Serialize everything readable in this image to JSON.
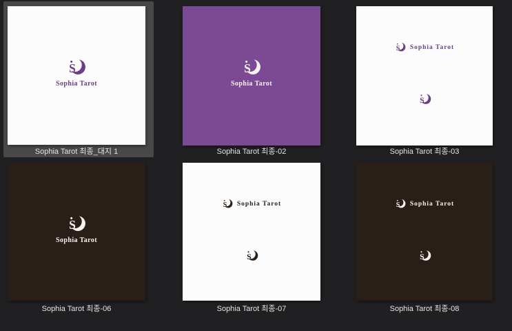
{
  "page": {
    "background": "#202022",
    "selection_highlight_color": "#48484a",
    "label_color": "#e4e4e4"
  },
  "brand": {
    "monogram": "S",
    "wordmark": "Sophia Tarot",
    "logo_purple": "#6b3f87",
    "card_purple": "#7c4a94",
    "card_dark_brown": "#2a1f18",
    "card_white": "#fcfcfc",
    "logo_light": "#f6f3ef"
  },
  "icons": {
    "logo_mark": "crescent-moon-with-monogram",
    "logo_dot": "accent-dot"
  },
  "tiles": [
    {
      "label": "Sophia Tarot 최종_대지 1",
      "layout": "stacked-center",
      "background": "white",
      "ink": "purple",
      "selected": true
    },
    {
      "label": "Sophia Tarot 최종-02",
      "layout": "stacked-center",
      "background": "purple",
      "ink": "light",
      "selected": false
    },
    {
      "label": "Sophia Tarot 최종-03",
      "layout": "horizontal-plus-solo",
      "background": "white",
      "ink": "purple",
      "selected": false
    },
    {
      "label": "Sophia Tarot 최종-06",
      "layout": "stacked-center",
      "background": "dark",
      "ink": "light",
      "selected": false
    },
    {
      "label": "Sophia Tarot 최종-07",
      "layout": "horizontal-plus-solo",
      "background": "white",
      "ink": "dark",
      "selected": false
    },
    {
      "label": "Sophia Tarot 최종-08",
      "layout": "horizontal-plus-solo",
      "background": "dark",
      "ink": "light",
      "selected": false
    }
  ]
}
